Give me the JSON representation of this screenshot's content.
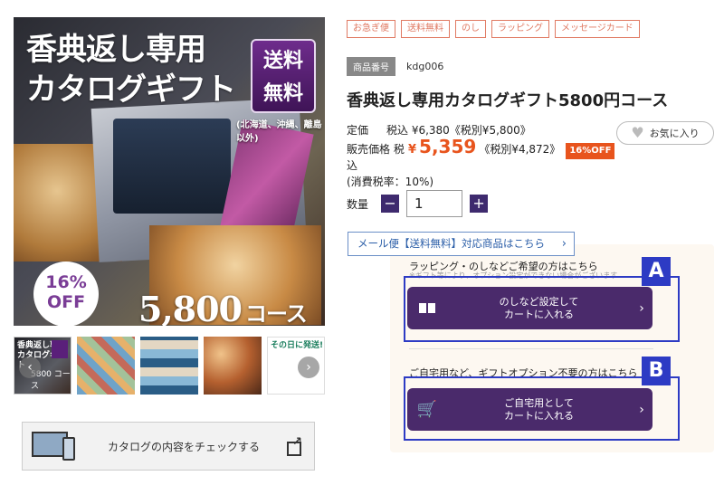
{
  "hero": {
    "title_line1": "香典返し専用",
    "title_line2": "カタログギフト",
    "badge_line1": "送料",
    "badge_line2": "無料",
    "badge_note": "(北海道、沖縄、離島以外)",
    "discount_pct": "16%",
    "discount_word": "OFF",
    "course_number": "5,800",
    "course_unit": "コース"
  },
  "thumbnails": [
    {
      "label": "香典返し専用\nカタログギフト",
      "course": "5800 コース",
      "selected": true
    },
    {
      "label": "",
      "selected": false
    },
    {
      "label": "",
      "selected": false
    },
    {
      "label": "",
      "selected": false
    },
    {
      "label": "その日に発送!",
      "selected": false
    }
  ],
  "catalog_button": {
    "label": "カタログの内容をチェックする"
  },
  "tags": [
    "お急ぎ便",
    "送料無料",
    "のし",
    "ラッピング",
    "メッセージカード"
  ],
  "product_code": {
    "label": "商品番号",
    "value": "kdg006"
  },
  "product_title": "香典返し専用カタログギフト5800円コース",
  "pricing": {
    "list_label": "定価",
    "list_price": "税込 ¥6,380《税別¥5,800》",
    "sale_label": "販売価格 税込",
    "sale_yen": "¥",
    "sale_amount": "5,359",
    "sale_excl": "《税別¥4,872》",
    "off_badge": "16%OFF",
    "tax_note": "(消費税率：10%)"
  },
  "favorite_button": {
    "label": "お気に入り"
  },
  "quantity": {
    "label": "数量",
    "value": "1",
    "minus": "−",
    "plus": "+"
  },
  "mail_link": {
    "label": "メール便【送料無料】対応商品はこちら"
  },
  "wrap_section": {
    "title": "ラッピング・のしなどご希望の方はこちら",
    "subtitle": "※ギフト等により、オプション設定ができない場合がございます",
    "button_line1": "のしなど設定して",
    "button_line2": "カートに入れる",
    "box_label": "A"
  },
  "self_section": {
    "title": "ご自宅用など、ギフトオプション不要の方はこちら",
    "button_line1": "ご自宅用として",
    "button_line2": "カートに入れる",
    "box_label": "B"
  },
  "colors": {
    "accent": "#e8541d",
    "brand_purple": "#4a2a6b",
    "highlight_box": "#2d3bc4",
    "tag_border": "#e07a63"
  }
}
